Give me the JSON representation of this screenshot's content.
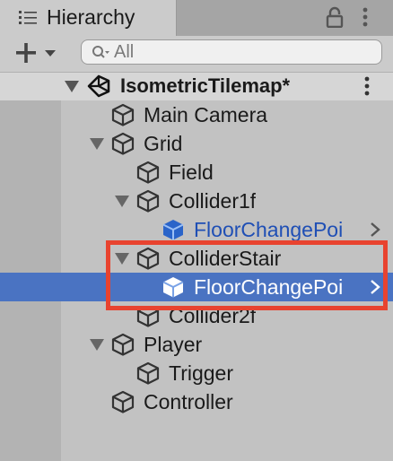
{
  "tab": {
    "title": "Hierarchy",
    "icon": "list-icon"
  },
  "toolbar": {
    "add_icon": "plus-icon",
    "search_placeholder": "All",
    "search_icon": "search-icon"
  },
  "scene": {
    "name": "IsometricTilemap*",
    "icon": "unity-icon"
  },
  "tree": [
    {
      "label": "Main Camera",
      "icon": "cube-icon",
      "expanded": null,
      "prefab": false,
      "selected": false
    },
    {
      "label": "Grid",
      "icon": "cube-icon",
      "expanded": true,
      "prefab": false,
      "selected": false
    },
    {
      "label": "Field",
      "icon": "cube-icon",
      "expanded": null,
      "prefab": false,
      "selected": false
    },
    {
      "label": "Collider1f",
      "icon": "cube-icon",
      "expanded": true,
      "prefab": false,
      "selected": false
    },
    {
      "label": "FloorChangePoi",
      "icon": "prefab-cube-icon",
      "expanded": null,
      "prefab": true,
      "selected": false,
      "has_child_arrow": true
    },
    {
      "label": "ColliderStair",
      "icon": "cube-icon",
      "expanded": true,
      "prefab": false,
      "selected": false
    },
    {
      "label": "FloorChangePoi",
      "icon": "prefab-cube-icon",
      "expanded": null,
      "prefab": true,
      "selected": true,
      "has_child_arrow": true
    },
    {
      "label": "Collider2f",
      "icon": "cube-icon",
      "expanded": null,
      "prefab": false,
      "selected": false
    },
    {
      "label": "Player",
      "icon": "cube-icon",
      "expanded": true,
      "prefab": false,
      "selected": false
    },
    {
      "label": "Trigger",
      "icon": "cube-icon",
      "expanded": null,
      "prefab": false,
      "selected": false
    },
    {
      "label": "Controller",
      "icon": "cube-icon",
      "expanded": null,
      "prefab": false,
      "selected": false
    }
  ],
  "colors": {
    "selection": "#4a73c2",
    "prefab_text": "#1f4fb5",
    "highlight": "#e8432f"
  }
}
